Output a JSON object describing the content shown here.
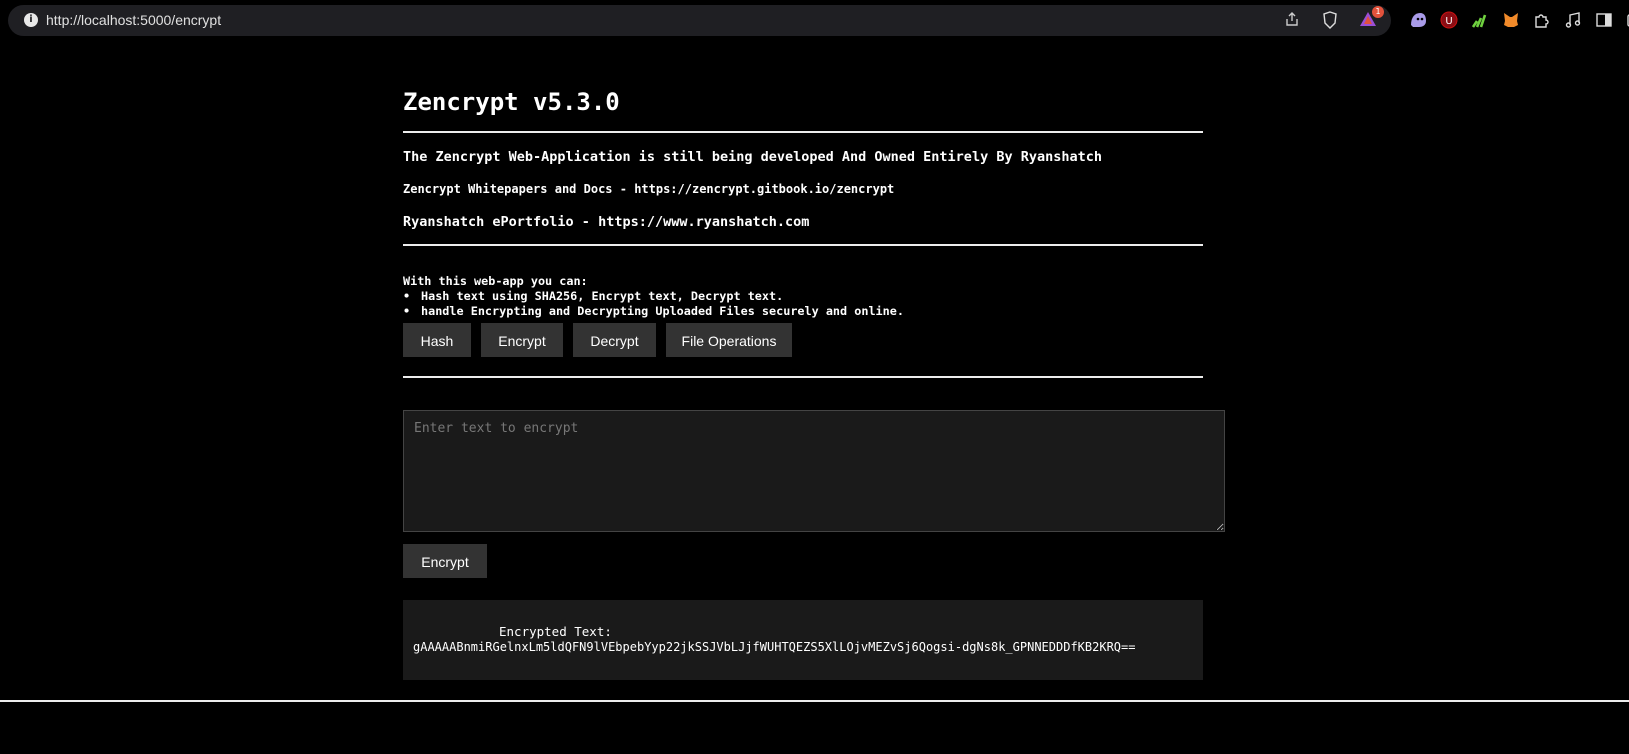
{
  "browser": {
    "url": "http://localhost:5000/encrypt",
    "brave_badge_count": "1",
    "icons": [
      "info-icon",
      "share-icon",
      "brave-shield-icon",
      "brave-rewards-icon"
    ],
    "extensions": [
      "ghost-extension-icon",
      "ublock-origin-icon",
      "chart-extension-icon",
      "metamask-icon",
      "extensions-puzzle-icon",
      "media-music-icon",
      "sidebar-icon",
      "wallet-icon"
    ]
  },
  "header": {
    "title": "Zencrypt v5.3.0",
    "notice": "The Zencrypt Web-Application is still being developed And Owned Entirely By Ryanshatch",
    "docs": "Zencrypt Whitepapers and Docs - https://zencrypt.gitbook.io/zencrypt",
    "portfolio": "Ryanshatch ePortfolio - https://www.ryanshatch.com"
  },
  "features": {
    "intro": "With this web-app you can:",
    "items": [
      "Hash text using SHA256, Encrypt text, Decrypt text.",
      "handle Encrypting and Decrypting Uploaded Files securely and online."
    ]
  },
  "nav": {
    "hash": "Hash",
    "encrypt": "Encrypt",
    "decrypt": "Decrypt",
    "file_ops": "File Operations"
  },
  "form": {
    "placeholder": "Enter text to encrypt",
    "submit": "Encrypt"
  },
  "result": {
    "label": "Encrypted Text:",
    "value": "gAAAAABnmiRGelnxLm5ldQFN9lVEbpebYyp22jkSSJVbLJjfWUHTQEZS5XlLOjvMEZvSj6Qogsi-dgNs8k_GPNNEDDDfKB2KRQ=="
  },
  "colors": {
    "background": "#000000",
    "button": "#333333",
    "panel": "#1a1a1a",
    "rule": "#ececec"
  }
}
